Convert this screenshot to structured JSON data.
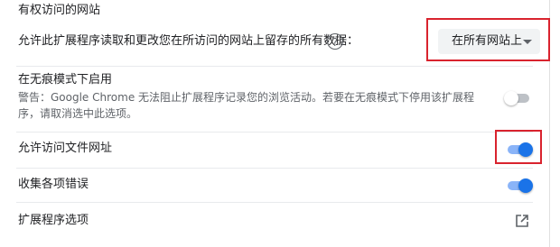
{
  "site_access": {
    "heading": "有权访问的网站",
    "label": "允许此扩展程序读取和更改您在所访问的网站上留存的所有数据：",
    "help_icon": "question-circle-icon",
    "select_value": "在所有网站上"
  },
  "incognito": {
    "title": "在无痕模式下启用",
    "description": "警告：Google Chrome 无法阻止扩展程序记录您的浏览活动。若要在无痕模式下停用该扩展程序，请取消选中此选项。",
    "enabled": false
  },
  "file_urls": {
    "label": "允许访问文件网址",
    "enabled": true
  },
  "collect_errors": {
    "label": "收集各项错误",
    "enabled": true
  },
  "extension_options": {
    "label": "扩展程序选项",
    "icon": "open-in-new-icon"
  },
  "colors": {
    "accent": "#1a73e8",
    "highlight": "#d9232e"
  }
}
